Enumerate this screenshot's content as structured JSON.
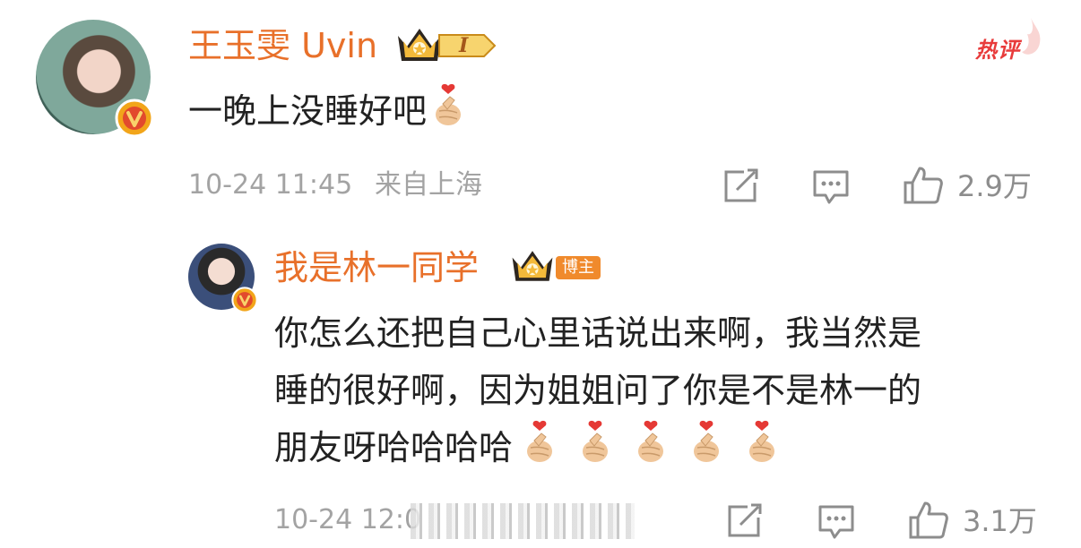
{
  "badge_hot": "热评",
  "comment": {
    "author": "王玉雯 Uvin",
    "level_badge": "I",
    "text": "一晚上没睡好吧",
    "date": "10-24 11:45",
    "location": "来自上海",
    "likes": "2.9万"
  },
  "reply": {
    "author": "我是林一同学",
    "author_badge": "博主",
    "lines": [
      "你怎么还把自己心里话说出来啊，我当然是",
      "睡的很好啊，因为姐姐问了你是不是林一的",
      "朋友呀哈哈哈哈"
    ],
    "date": "10-24 12:0",
    "likes": "3.1万"
  },
  "icons": {
    "verified": "verified-v-icon",
    "crown": "crown-icon",
    "heart_hand": "finger-heart-emoji",
    "share": "share-edit-icon",
    "comment": "comment-icon",
    "like": "thumb-up-icon"
  },
  "colors": {
    "name": "#e8702a",
    "text": "#222222",
    "meta": "#a3a3a3",
    "hot": "#e83b3b",
    "verified_gold": "#f2a51a",
    "verified_red": "#e24a2d"
  }
}
